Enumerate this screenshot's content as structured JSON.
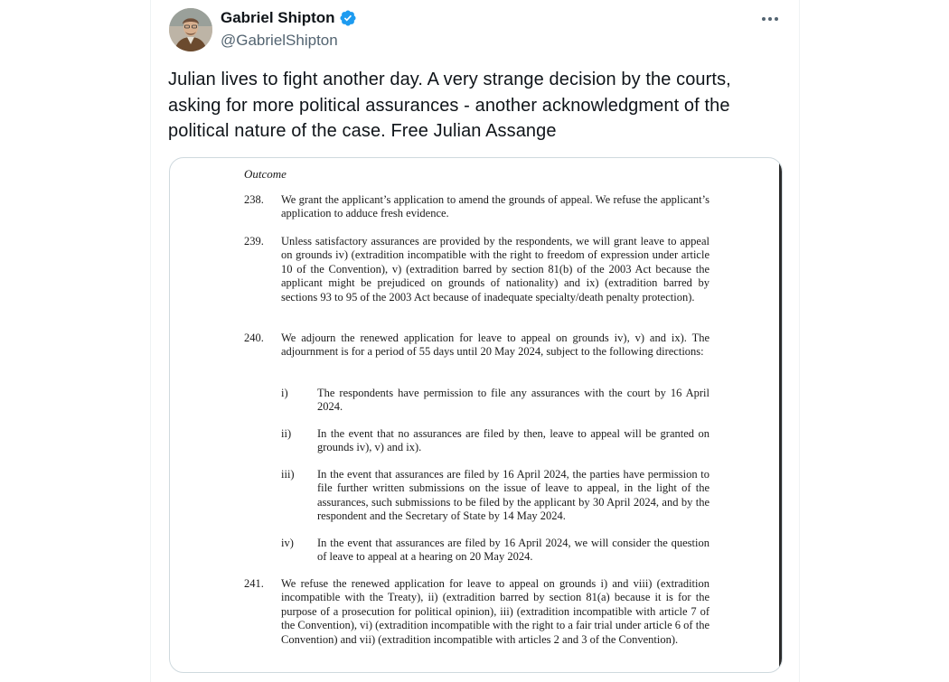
{
  "tweet": {
    "author_name": "Gabriel Shipton",
    "author_handle": "@GabrielShipton",
    "text": "Julian lives to fight another day. A very strange decision by the courts, asking for more political assurances - another acknowledgment of the political nature of the case. Free Julian Assange",
    "verified_icon": "verified-badge-icon",
    "more_icon": "more-options-icon",
    "colors": {
      "verified": "#1d9bf0",
      "handle": "#536471",
      "text": "#0f1419"
    }
  },
  "document": {
    "heading": "Outcome",
    "paragraphs": [
      {
        "num": "238.",
        "text": "We grant the applicant’s application to amend the grounds of appeal. We refuse the applicant’s application to adduce fresh evidence."
      },
      {
        "num": "239.",
        "text": "Unless satisfactory assurances are provided by the respondents, we will grant leave to appeal on grounds iv) (extradition incompatible with the right to freedom of expression under article 10 of the Convention), v) (extradition barred by section 81(b) of the 2003 Act because the applicant might be prejudiced on grounds of nationality) and ix) (extradition barred by sections 93 to 95 of the 2003 Act because of inadequate specialty/death penalty protection)."
      },
      {
        "num": "240.",
        "text": "We adjourn the renewed application for leave to appeal on grounds iv), v) and ix). The adjournment is for a period of 55 days until 20 May 2024, subject to the following directions:"
      },
      {
        "num": "241.",
        "text": "We refuse the renewed application for leave to appeal on grounds i) and viii) (extradition incompatible with the Treaty), ii) (extradition barred by section 81(a) because it is for the purpose of a prosecution for political opinion), iii) (extradition incompatible with article 7 of the Convention), vi) (extradition incompatible with the right to a fair trial under article 6 of the Convention) and vii) (extradition incompatible with articles 2 and 3 of the Convention)."
      }
    ],
    "directions": [
      {
        "num": "i)",
        "text": "The respondents have permission to file any assurances with the court by 16 April 2024."
      },
      {
        "num": "ii)",
        "text": "In the event that no assurances are filed by then, leave to appeal will be granted on grounds iv), v) and ix)."
      },
      {
        "num": "iii)",
        "text": "In the event that assurances are filed by 16 April 2024, the parties have permission to file further written submissions on the issue of leave to appeal, in the light of the assurances, such submissions to be filed by the applicant by 30 April 2024, and by the respondent and the Secretary of State by 14 May 2024."
      },
      {
        "num": "iv)",
        "text": "In the event that assurances are filed by 16 April 2024, we will consider the question of leave to appeal at a hearing on 20 May 2024."
      }
    ]
  }
}
